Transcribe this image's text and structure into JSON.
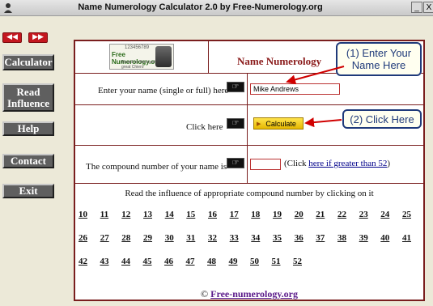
{
  "window": {
    "title": "Name Numerology Calculator 2.0 by Free-Numerology.org",
    "min_glyph": "_",
    "close_glyph": "X"
  },
  "nav": {
    "back_glyph": "◀◀",
    "forward_glyph": "▶▶"
  },
  "sidebar": [
    {
      "name": "calculator-button",
      "label": "Calculator"
    },
    {
      "name": "read-influence-button",
      "label": "Read Influence"
    },
    {
      "name": "help-button",
      "label": "Help"
    },
    {
      "name": "contact-button",
      "label": "Contact"
    },
    {
      "name": "exit-button",
      "label": "Exit"
    }
  ],
  "logo": {
    "top_text": "123456789",
    "main_text": "Free Numerology.org",
    "sub_text": "Based on the teachings of great Chiero"
  },
  "header": {
    "title": "Name Numerology"
  },
  "form": {
    "name_label": "Enter your name (single or full) here",
    "name_value": "Mike Andrews",
    "click_label": "Click here",
    "calculate_label": "Calculate",
    "compound_label": "The compound number of your name is",
    "click_prefix": "(Click ",
    "click_link": "here if greater than 52",
    "click_suffix": ")"
  },
  "influence": {
    "instruction": "Read the influence of appropriate compound number by clicking on it",
    "rows": [
      [
        "10",
        "11",
        "12",
        "13",
        "14",
        "15",
        "16",
        "17",
        "18",
        "19",
        "20",
        "21",
        "22",
        "23",
        "24",
        "25"
      ],
      [
        "26",
        "27",
        "28",
        "29",
        "30",
        "31",
        "32",
        "33",
        "34",
        "35",
        "36",
        "37",
        "38",
        "39",
        "40",
        "41"
      ],
      [
        "42",
        "43",
        "44",
        "45",
        "46",
        "47",
        "48",
        "49",
        "50",
        "51",
        "52"
      ]
    ]
  },
  "footer": {
    "copyright_symbol": "©",
    "link": "Free-numerology.org"
  },
  "callouts": {
    "step1": "(1) Enter Your Name Here",
    "step2": "(2) Click Here"
  },
  "colors": {
    "accent": "#7a1e1e",
    "callout_border": "#1f3a7a",
    "nav_arrow": "#c4171f"
  }
}
